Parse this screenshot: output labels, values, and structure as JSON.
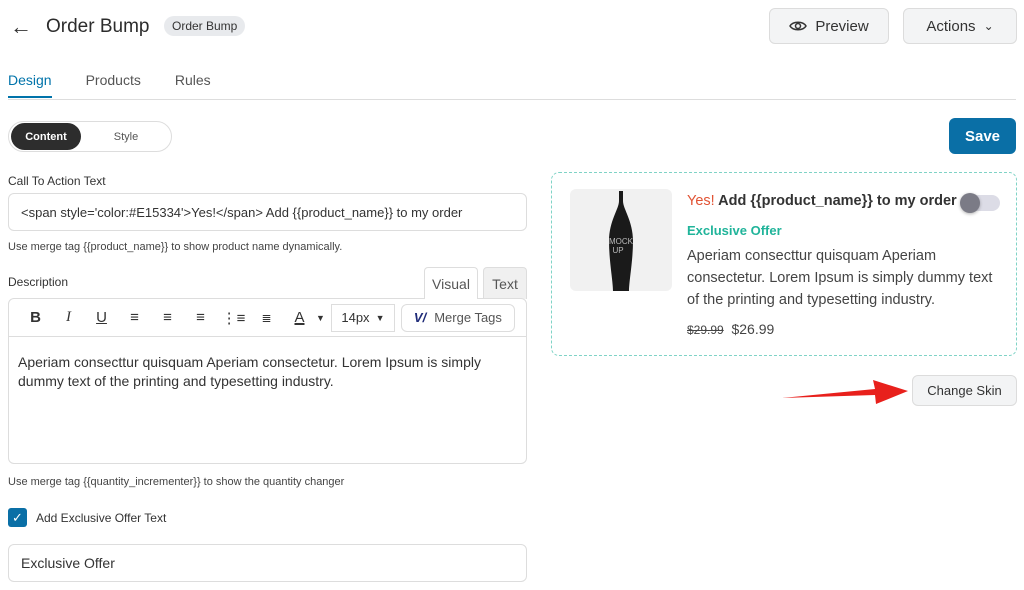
{
  "header": {
    "back_icon": "arrow-left-icon",
    "title": "Order Bump",
    "badge": "Order Bump",
    "preview_label": "Preview",
    "actions_label": "Actions"
  },
  "tabs": [
    {
      "label": "Design",
      "active": true
    },
    {
      "label": "Products"
    },
    {
      "label": "Rules"
    }
  ],
  "segment": {
    "content": "Content",
    "style": "Style"
  },
  "save_label": "Save",
  "cta": {
    "label": "Call To Action Text",
    "value": "<span style='color:#E15334'>Yes!</span> Add {{product_name}} to my order",
    "help": "Use merge tag {{product_name}} to show product name dynamically."
  },
  "description": {
    "label": "Description",
    "tab_visual": "Visual",
    "tab_text": "Text",
    "font_size": "14px",
    "merge_tags": "Merge Tags",
    "text": "Aperiam consecttur quisquam Aperiam consectetur. Lorem Ipsum is simply dummy text of the printing and typesetting industry.",
    "help": "Use merge tag {{quantity_incrementer}} to show the quantity changer"
  },
  "exclusive": {
    "checkbox_label": "Add Exclusive Offer Text",
    "checked": true,
    "value": "Exclusive Offer"
  },
  "preview": {
    "yes": "Yes!",
    "cta_rest": " Add {{product_name}} to my order",
    "exclusive": "Exclusive Offer",
    "desc": "Aperiam consecttur quisquam Aperiam consectetur. Lorem Ipsum is simply dummy text of the printing and typesetting industry.",
    "old_price": "$29.99",
    "price": "$26.99",
    "image_text": "MOCK UP",
    "toggle_on": false
  },
  "change_skin": "Change Skin",
  "colors": {
    "accent": "#0a6fa6",
    "yes": "#E15334",
    "exclusive": "#20b49a",
    "arrow": "#e8201c"
  }
}
